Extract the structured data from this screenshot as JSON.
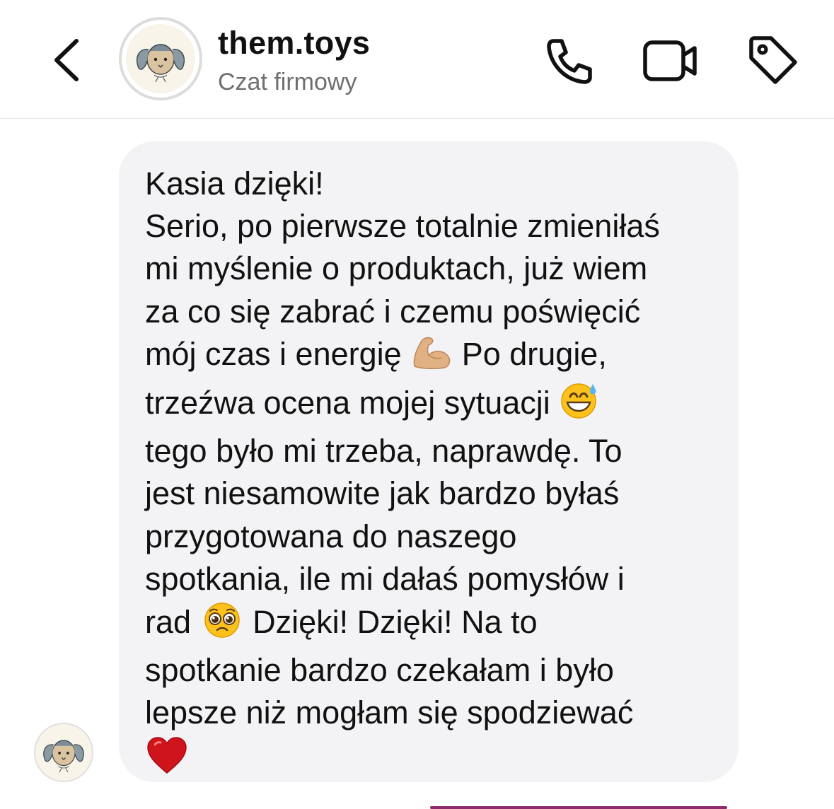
{
  "header": {
    "back_icon": "chevron-left-icon",
    "name": "them.toys",
    "subtitle": "Czat firmowy",
    "avatar_icon": "bunny-logo",
    "actions": [
      "phone-icon",
      "video-camera-icon",
      "tag-icon"
    ]
  },
  "message": {
    "lines": [
      "Kasia dzięki!",
      "Serio, po pierwsze totalnie zmieniłaś",
      "mi myślenie o produktach, już wiem",
      "za co się zabrać i czemu poświęcić",
      "mój czas i energię",
      "Po drugie,",
      "trzeźwa ocena mojej sytuacji",
      "tego było mi trzeba, naprawdę. To",
      "jest niesamowite jak bardzo byłaś",
      "przygotowana do naszego",
      "spotkania, ile mi dałaś pomysłów i",
      "rad",
      "Dzięki! Dzięki! Na to",
      "spotkanie bardzo czekałam i było",
      "lepsze niż mogłam się spodziewać"
    ],
    "emojis": [
      "flexed-biceps-emoji",
      "grinning-sweat-emoji",
      "pleading-face-emoji",
      "red-heart-emoji"
    ]
  },
  "colors": {
    "bubble_bg": "#f3f3f5",
    "subtitle": "#6f6f6f",
    "accent_bar": "#8c2a6a",
    "heart": "#d0141c"
  }
}
